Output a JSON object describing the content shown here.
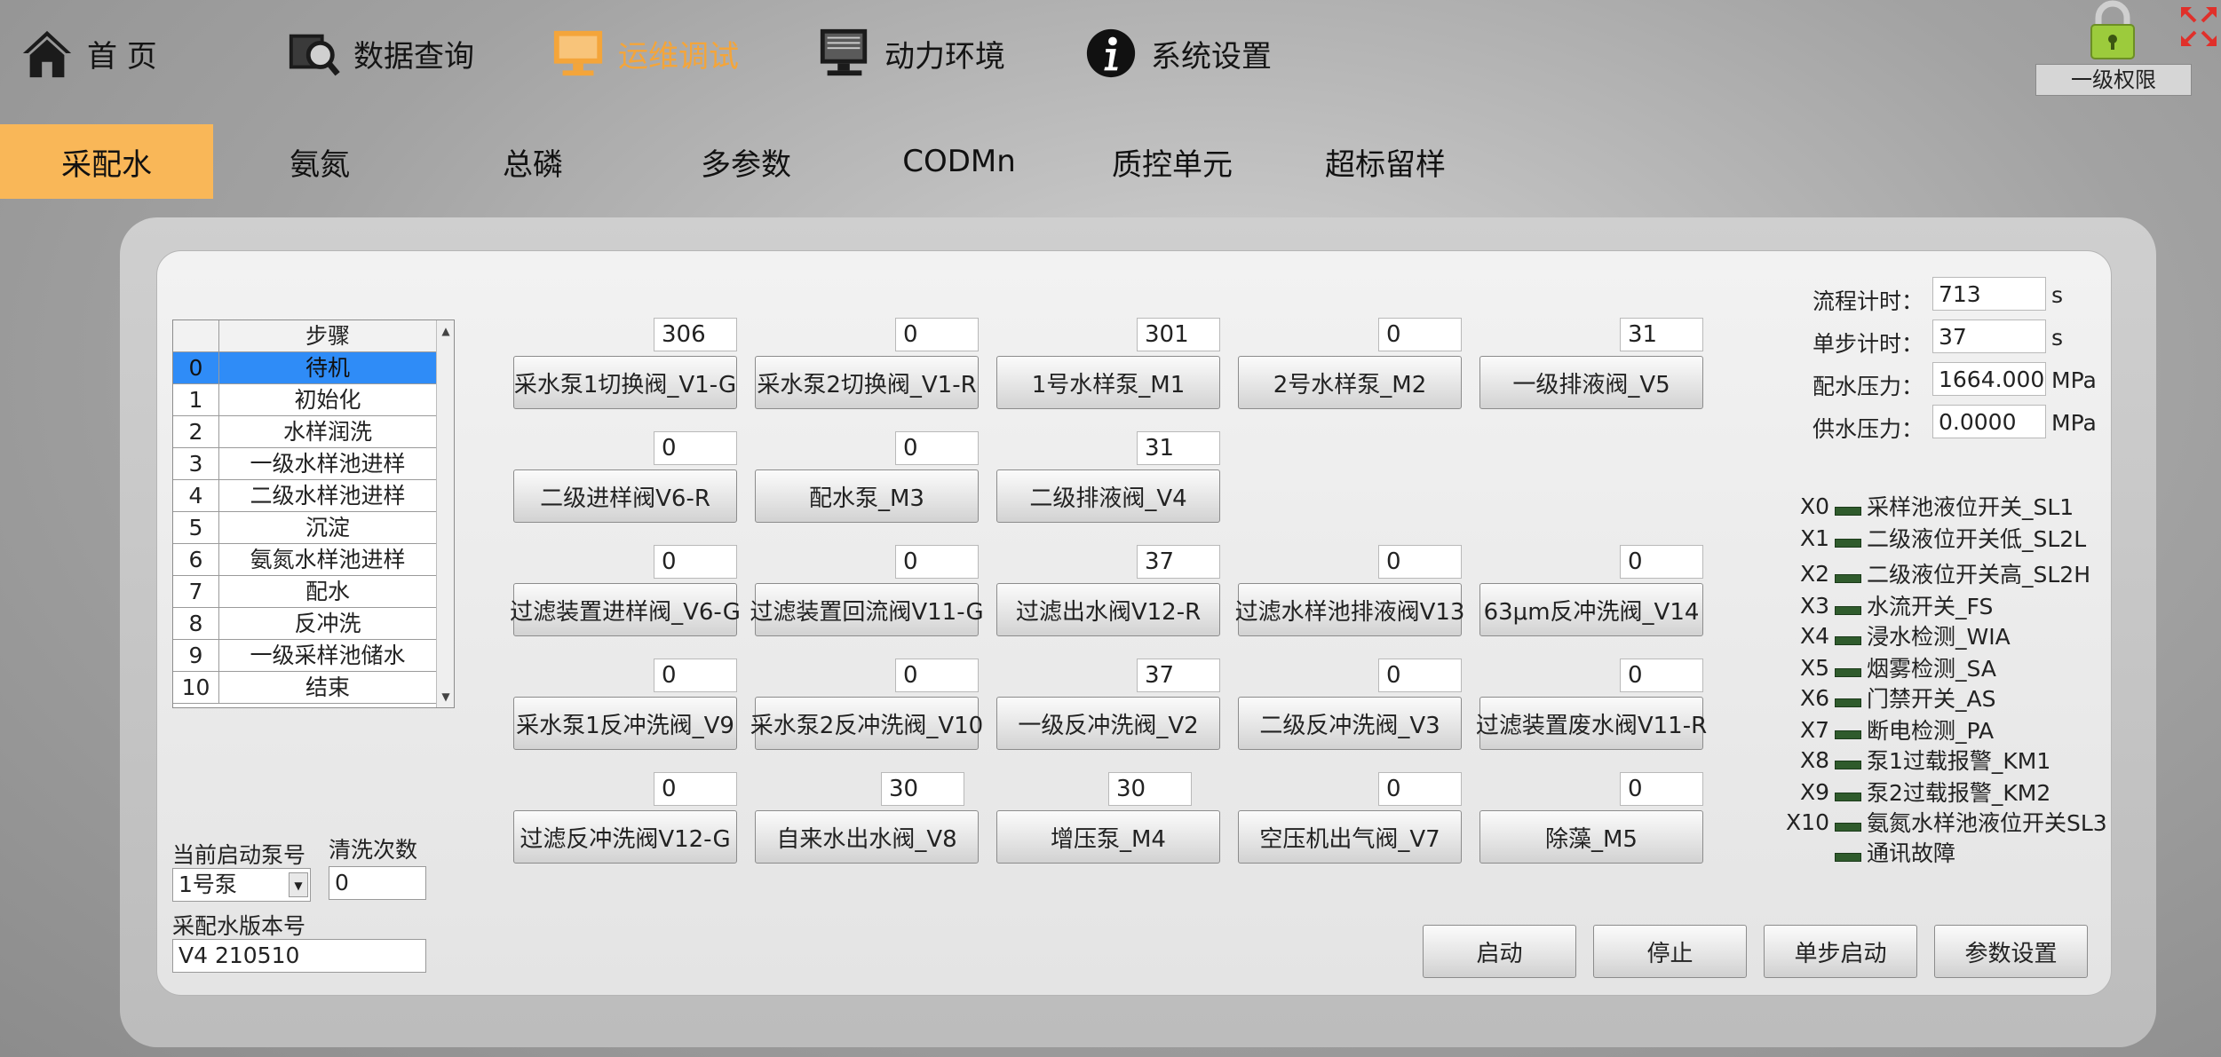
{
  "nav": {
    "items": [
      {
        "label": "首 页",
        "icon": "home-icon"
      },
      {
        "label": "数据查询",
        "icon": "search-folder-icon"
      },
      {
        "label": "运维调试",
        "icon": "monitor-tools-icon"
      },
      {
        "label": "动力环境",
        "icon": "computer-icon"
      },
      {
        "label": "系统设置",
        "icon": "info-icon"
      }
    ],
    "active_index": 2,
    "active_color": "#f4a53a",
    "permission": "一级权限"
  },
  "tabs": {
    "items": [
      "采配水",
      "氨氮",
      "总磷",
      "多参数",
      "CODMn",
      "质控单元",
      "超标留样"
    ],
    "active_index": 0,
    "active_color": "#f9b758"
  },
  "steps": {
    "header": "步骤",
    "rows": [
      {
        "no": "0",
        "name": "待机"
      },
      {
        "no": "1",
        "name": "初始化"
      },
      {
        "no": "2",
        "name": "水样润洗"
      },
      {
        "no": "3",
        "name": "一级水样池进样"
      },
      {
        "no": "4",
        "name": "二级水样池进样"
      },
      {
        "no": "5",
        "name": "沉淀"
      },
      {
        "no": "6",
        "name": "氨氮水样池进样"
      },
      {
        "no": "7",
        "name": "配水"
      },
      {
        "no": "8",
        "name": "反冲洗"
      },
      {
        "no": "9",
        "name": "一级采样池储水"
      },
      {
        "no": "10",
        "name": "结束"
      }
    ],
    "selected_index": 0
  },
  "valves": [
    {
      "label": "采水泵1切换阀_V1-G",
      "count": "306"
    },
    {
      "label": "采水泵2切换阀_V1-R",
      "count": "0"
    },
    {
      "label": "1号水样泵_M1",
      "count": "301"
    },
    {
      "label": "2号水样泵_M2",
      "count": "0"
    },
    {
      "label": "一级排液阀_V5",
      "count": "31"
    },
    {
      "label": "二级进样阀V6-R",
      "count": "0"
    },
    {
      "label": "配水泵_M3",
      "count": "0"
    },
    {
      "label": "二级排液阀_V4",
      "count": "31"
    },
    {
      "label": "过滤装置进样阀_V6-G",
      "count": "0"
    },
    {
      "label": "过滤装置回流阀V11-G",
      "count": "0"
    },
    {
      "label": "过滤出水阀V12-R",
      "count": "37"
    },
    {
      "label": "过滤水样池排液阀V13",
      "count": "0"
    },
    {
      "label": "63μm反冲洗阀_V14",
      "count": "0"
    },
    {
      "label": "采水泵1反冲洗阀_V9",
      "count": "0"
    },
    {
      "label": "采水泵2反冲洗阀_V10",
      "count": "0"
    },
    {
      "label": "一级反冲洗阀_V2",
      "count": "37"
    },
    {
      "label": "二级反冲洗阀_V3",
      "count": "0"
    },
    {
      "label": "过滤装置废水阀V11-R",
      "count": "0"
    },
    {
      "label": "过滤反冲洗阀V12-G",
      "count": "0"
    },
    {
      "label": "自来水出水阀_V8",
      "count": "30"
    },
    {
      "label": "增压泵_M4",
      "count": "30"
    },
    {
      "label": "空压机出气阀_V7",
      "count": "0"
    },
    {
      "label": "除藻_M5",
      "count": "0"
    }
  ],
  "status": {
    "flow_timer": {
      "label": "流程计时：",
      "value": "713",
      "unit": "s"
    },
    "step_timer": {
      "label": "单步计时：",
      "value": "37",
      "unit": "s"
    },
    "dist_pressure": {
      "label": "配水压力：",
      "value": "1664.0000",
      "unit": "MPa"
    },
    "supply_pressure": {
      "label": "供水压力：",
      "value": "0.0000",
      "unit": "MPa"
    }
  },
  "io": [
    {
      "key": "X0",
      "label": "采样池液位开关_SL1"
    },
    {
      "key": "X1",
      "label": "二级液位开关低_SL2L"
    },
    {
      "key": "X2",
      "label": "二级液位开关高_SL2H"
    },
    {
      "key": "X3",
      "label": "水流开关_FS"
    },
    {
      "key": "X4",
      "label": "浸水检测_WIA"
    },
    {
      "key": "X5",
      "label": "烟雾检测_SA"
    },
    {
      "key": "X6",
      "label": "门禁开关_AS"
    },
    {
      "key": "X7",
      "label": "断电检测_PA"
    },
    {
      "key": "X8",
      "label": "泵1过载报警_KM1"
    },
    {
      "key": "X9",
      "label": "泵2过载报警_KM2"
    },
    {
      "key": "X10",
      "label": "氨氮水样池液位开关SL3"
    },
    {
      "key": "",
      "label": "通讯故障"
    }
  ],
  "io_led_color": "#2f5b2c",
  "bottom_left": {
    "pump_label": "当前启动泵号",
    "pump_value": "1号泵",
    "wash_label": "清洗次数",
    "wash_value": "0",
    "version_label": "采配水版本号",
    "version_value": "V4 210510"
  },
  "actions": [
    "启动",
    "停止",
    "单步启动",
    "参数设置"
  ]
}
